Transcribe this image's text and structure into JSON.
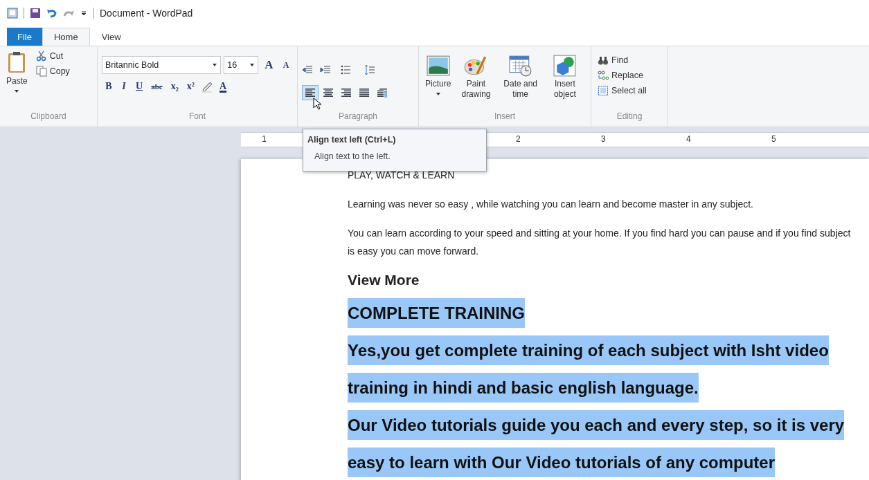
{
  "window": {
    "title": "Document - WordPad"
  },
  "tabs": [
    {
      "label": "File",
      "kind": "file",
      "selected": false
    },
    {
      "label": "Home",
      "kind": "tab",
      "selected": true
    },
    {
      "label": "View",
      "kind": "tab",
      "selected": false
    }
  ],
  "ribbon": {
    "clipboard": {
      "label": "Clipboard",
      "paste": "Paste",
      "cut": "Cut",
      "copy": "Copy"
    },
    "font": {
      "label": "Font",
      "family": "Britannic Bold",
      "size": "16",
      "grow": "A",
      "shrink": "A",
      "format_buttons": [
        {
          "label": "B",
          "kind": "bold"
        },
        {
          "label": "I",
          "kind": "italic"
        },
        {
          "label": "U",
          "kind": "underline"
        },
        {
          "label": "abc",
          "kind": "strike"
        },
        {
          "label": "x₂",
          "kind": "sub"
        },
        {
          "label": "x²",
          "kind": "sup"
        }
      ],
      "color_label": "A"
    },
    "paragraph": {
      "label": "Paragraph",
      "align_buttons": [
        {
          "kind": "left",
          "selected": true
        },
        {
          "kind": "center",
          "selected": false
        },
        {
          "kind": "right",
          "selected": false
        },
        {
          "kind": "justify",
          "selected": false
        },
        {
          "kind": "para",
          "selected": false
        }
      ]
    },
    "insert": {
      "label": "Insert",
      "items": [
        {
          "label": "Picture",
          "kind": "picture"
        },
        {
          "label": "Paint drawing",
          "kind": "paint"
        },
        {
          "label": "Date and time",
          "kind": "date"
        },
        {
          "label": "Insert object",
          "kind": "object"
        }
      ]
    },
    "editing": {
      "label": "Editing",
      "items": [
        {
          "label": "Find",
          "kind": "find"
        },
        {
          "label": "Replace",
          "kind": "replace"
        },
        {
          "label": "Select all",
          "kind": "selectall"
        }
      ]
    }
  },
  "ruler": {
    "numbers": [
      "1",
      "2",
      "3",
      "4",
      "5"
    ]
  },
  "tooltip": {
    "title": "Align text left (Ctrl+L)",
    "text": "Align text to the left."
  },
  "document": {
    "paragraphs": [
      {
        "text": "PLAY, WATCH & LEARN",
        "kind": "normal",
        "selected": false
      },
      {
        "text": "Learning was never so easy , while watching you can learn and become master in any subject.",
        "kind": "normal",
        "selected": false
      },
      {
        "text": "You can learn according to your speed and sitting at your home. If you find hard you can pause and if you find subject is easy you can move forward.",
        "kind": "normal",
        "selected": false
      },
      {
        "text": "View More",
        "kind": "heading",
        "selected": false
      },
      {
        "text": "COMPLETE TRAINING",
        "kind": "display",
        "selected": true
      },
      {
        "text": "Yes,you get complete training of each subject with Isht video training in hindi and basic english language.",
        "kind": "display",
        "selected": true
      },
      {
        "text": "Our Video tutorials guide you each and every step, so it is very easy to learn with Our Video tutorials of any computer",
        "kind": "display",
        "selected": true
      }
    ]
  }
}
